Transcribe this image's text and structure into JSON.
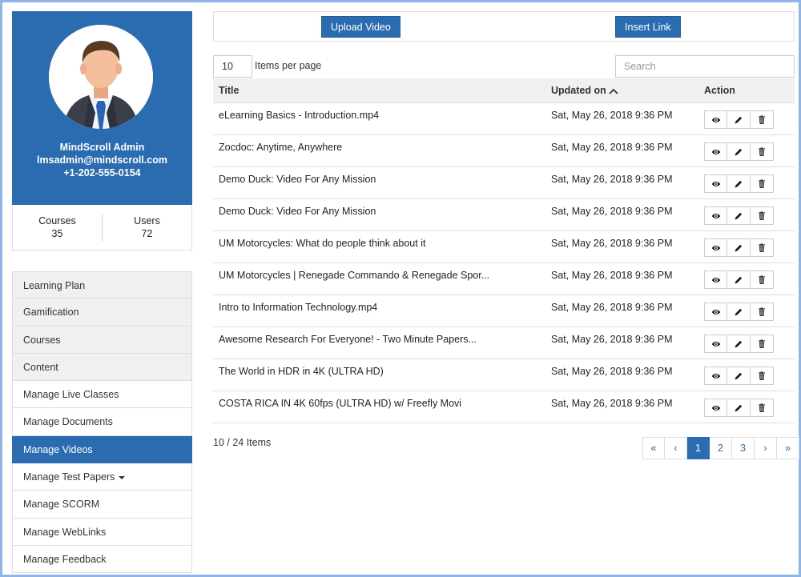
{
  "profile": {
    "name": "MindScroll Admin",
    "email": "lmsadmin@mindscroll.com",
    "phone": "+1-202-555-0154",
    "avatar_icon": "businessman-avatar-icon"
  },
  "stats": {
    "courses_label": "Courses",
    "courses_value": "35",
    "users_label": "Users",
    "users_value": "72"
  },
  "nav": {
    "items": [
      {
        "label": "Learning Plan"
      },
      {
        "label": "Gamification"
      },
      {
        "label": "Courses"
      },
      {
        "label": "Content"
      },
      {
        "label": "Manage Live Classes"
      },
      {
        "label": "Manage Documents"
      },
      {
        "label": "Manage Videos"
      },
      {
        "label": "Manage Test Papers"
      },
      {
        "label": "Manage SCORM"
      },
      {
        "label": "Manage WebLinks"
      },
      {
        "label": "Manage Feedback"
      }
    ],
    "active_label": "Manage Videos"
  },
  "toolbar": {
    "upload_label": "Upload Video",
    "link_label": "Insert Link"
  },
  "list": {
    "per_page_value": "10",
    "per_page_label": "Items per page",
    "search_placeholder": "Search"
  },
  "table": {
    "headers": {
      "title": "Title",
      "updated": "Updated on",
      "action": "Action"
    },
    "sort_icon": "chevron-up-icon",
    "action_icons": [
      "eye-icon",
      "pencil-icon",
      "trash-icon"
    ],
    "rows": [
      {
        "title": "eLearning Basics - Introduction.mp4",
        "updated": "Sat, May 26, 2018 9:36 PM"
      },
      {
        "title": "Zocdoc: Anytime, Anywhere",
        "updated": "Sat, May 26, 2018 9:36 PM"
      },
      {
        "title": "Demo Duck: Video For Any Mission",
        "updated": "Sat, May 26, 2018 9:36 PM"
      },
      {
        "title": "Demo Duck: Video For Any Mission",
        "updated": "Sat, May 26, 2018 9:36 PM"
      },
      {
        "title": "UM Motorcycles: What do people think about it",
        "updated": "Sat, May 26, 2018 9:36 PM"
      },
      {
        "title": "UM Motorcycles | Renegade Commando & Renegade Spor...",
        "updated": "Sat, May 26, 2018 9:36 PM"
      },
      {
        "title": "Intro to Information Technology.mp4",
        "updated": "Sat, May 26, 2018 9:36 PM"
      },
      {
        "title": "Awesome Research For Everyone! - Two Minute Papers...",
        "updated": "Sat, May 26, 2018 9:36 PM"
      },
      {
        "title": "The World in HDR in 4K (ULTRA HD)",
        "updated": "Sat, May 26, 2018 9:36 PM"
      },
      {
        "title": "COSTA RICA IN 4K 60fps (ULTRA HD) w/ Freefly Movi",
        "updated": "Sat, May 26, 2018 9:36 PM"
      }
    ]
  },
  "footer": {
    "items_count": "10 / 24 Items"
  },
  "pagination": {
    "first": "«",
    "prev": "‹",
    "pages": [
      "1",
      "2",
      "3"
    ],
    "current": "1",
    "next": "›",
    "last": "»"
  },
  "colors": {
    "accent": "#2b6cb0",
    "frame_border": "#8fb4e8"
  }
}
